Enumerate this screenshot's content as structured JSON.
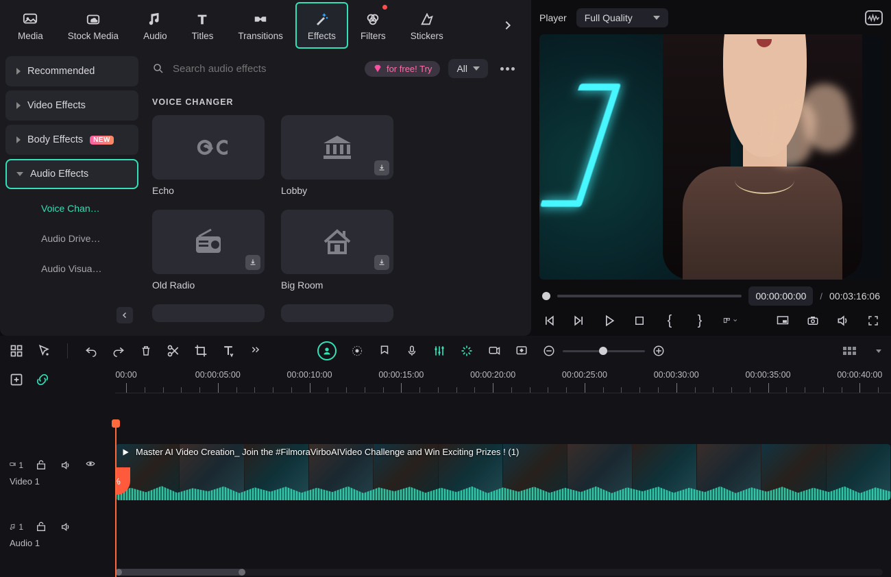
{
  "topTabs": {
    "items": [
      {
        "key": "media",
        "label": "Media"
      },
      {
        "key": "stock",
        "label": "Stock Media"
      },
      {
        "key": "audio",
        "label": "Audio"
      },
      {
        "key": "titles",
        "label": "Titles"
      },
      {
        "key": "transitions",
        "label": "Transitions"
      },
      {
        "key": "effects",
        "label": "Effects",
        "active": true
      },
      {
        "key": "filters",
        "label": "Filters",
        "dot": true
      },
      {
        "key": "stickers",
        "label": "Stickers"
      }
    ]
  },
  "sidebar": {
    "items": [
      {
        "label": "Recommended"
      },
      {
        "label": "Video Effects"
      },
      {
        "label": "Body Effects",
        "badge": "NEW"
      },
      {
        "label": "Audio Effects",
        "open": true,
        "selected": true
      }
    ],
    "sub": [
      {
        "label": "Voice Chan…",
        "active": true
      },
      {
        "label": "Audio Drive…"
      },
      {
        "label": "Audio Visua…"
      }
    ]
  },
  "search": {
    "placeholder": "Search audio effects"
  },
  "tryPill": " for free! Try",
  "allSelect": "All",
  "section": {
    "title": "VOICE CHANGER"
  },
  "effects": [
    {
      "name": "Echo",
      "icon": "infinity",
      "dl": false
    },
    {
      "name": "Lobby",
      "icon": "bank",
      "dl": true
    },
    {
      "name": "Old Radio",
      "icon": "radio",
      "dl": true
    },
    {
      "name": "Big Room",
      "icon": "house",
      "dl": true
    }
  ],
  "player": {
    "title": "Player",
    "quality": "Full Quality",
    "currentTime": "00:00:00:00",
    "sep": "/",
    "totalTime": "00:03:16:06"
  },
  "ruler": {
    "labels": [
      "00:00",
      "00:00:05:00",
      "00:00:10:00",
      "00:00:15:00",
      "00:00:20:00",
      "00:00:25:00",
      "00:00:30:00",
      "00:00:35:00",
      "00:00:40:00"
    ]
  },
  "tracks": {
    "video": {
      "badge": "1",
      "label": "Video 1",
      "clipTitle": "Master AI Video Creation_ Join the #FilmoraVirboAIVideo Challenge and Win Exciting Prizes ! (1)"
    },
    "audio": {
      "badge": "1",
      "label": "Audio 1"
    }
  },
  "zoom": {
    "pos": 44
  }
}
